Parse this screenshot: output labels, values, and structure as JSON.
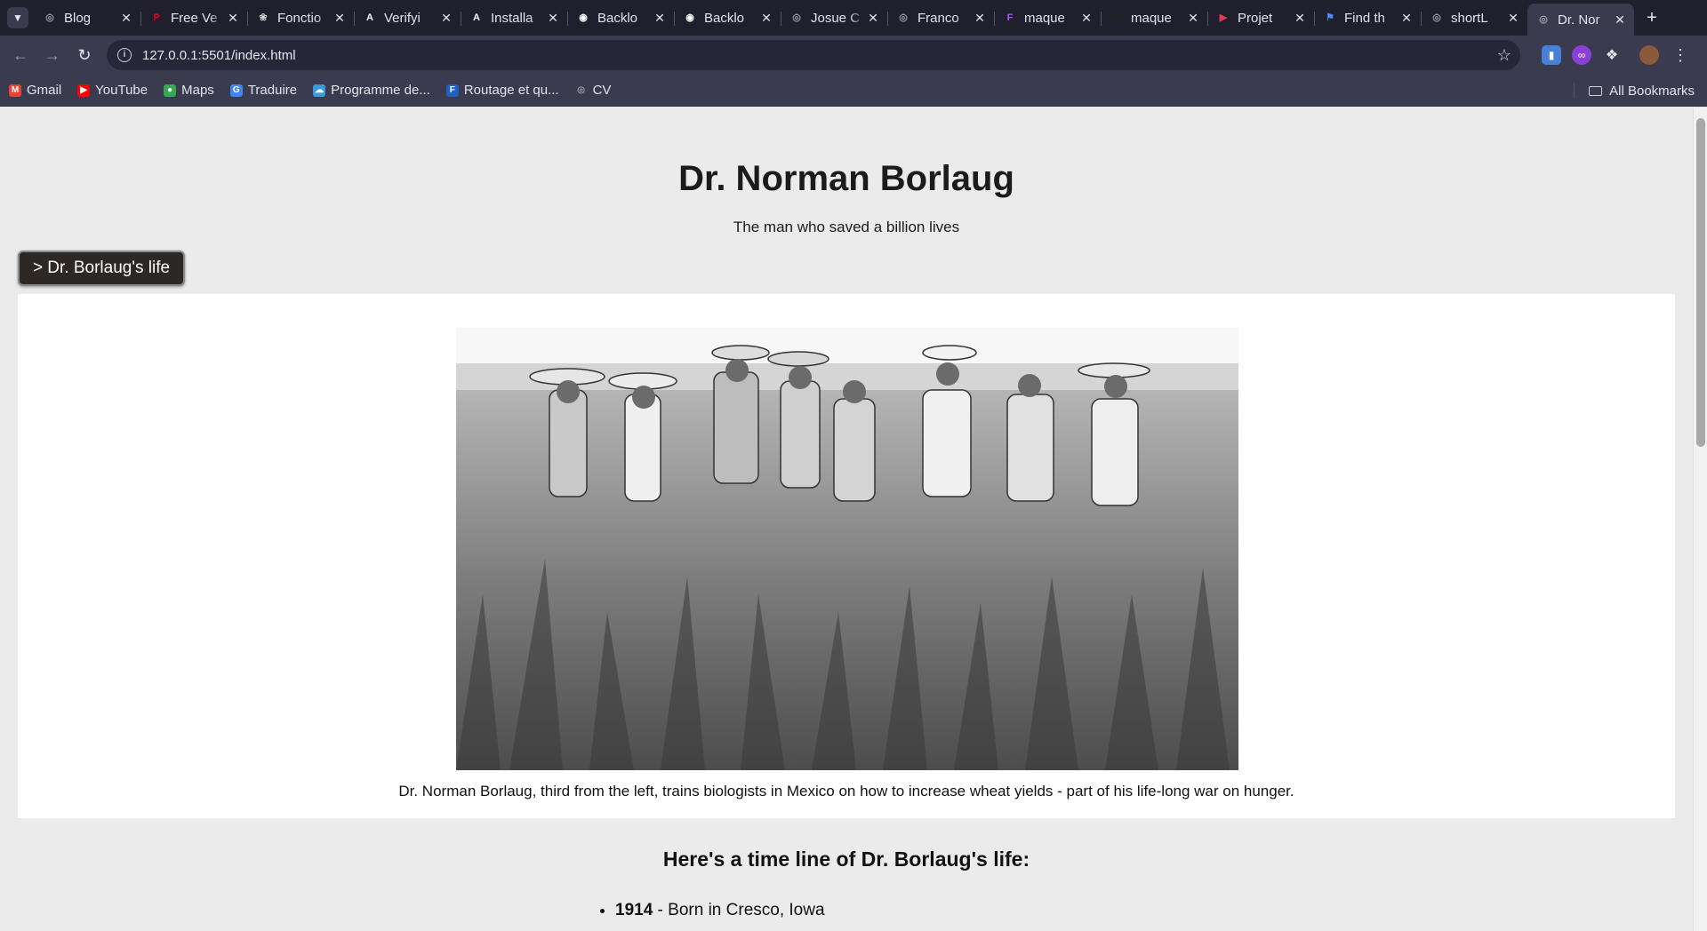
{
  "browser": {
    "tabs": [
      {
        "title": "Blog",
        "icon": "globe-icon",
        "color": "#9aa0a6"
      },
      {
        "title": "Free Ve",
        "icon": "pinterest-icon",
        "color": "#e60023"
      },
      {
        "title": "Fonctio",
        "icon": "openai-icon",
        "color": "#cfcfcf"
      },
      {
        "title": "Verifyi",
        "icon": "auth-icon",
        "color": "#ffffff"
      },
      {
        "title": "Installa",
        "icon": "auth-icon",
        "color": "#ffffff"
      },
      {
        "title": "Backlo",
        "icon": "github-icon",
        "color": "#ffffff"
      },
      {
        "title": "Backlo",
        "icon": "github-icon",
        "color": "#ffffff"
      },
      {
        "title": "Josue C",
        "icon": "globe-icon",
        "color": "#9aa0a6"
      },
      {
        "title": "Franco",
        "icon": "globe-icon",
        "color": "#9aa0a6"
      },
      {
        "title": "maque",
        "icon": "figma-icon",
        "color": "#a259ff"
      },
      {
        "title": "maque",
        "icon": "play-icon",
        "color": "#222222"
      },
      {
        "title": "Projet",
        "icon": "play-icon",
        "color": "#e8364f"
      },
      {
        "title": "Find th",
        "icon": "flag-icon",
        "color": "#4a8cf7"
      },
      {
        "title": "shortL",
        "icon": "globe-icon",
        "color": "#9aa0a6"
      },
      {
        "title": "Dr. Nor",
        "icon": "globe-icon",
        "color": "#9aa0a6",
        "active": true
      }
    ],
    "url": "127.0.0.1:5501/index.html",
    "bookmarks": [
      {
        "label": "Gmail",
        "icon": "gmail-icon",
        "color": "#ea4335"
      },
      {
        "label": "YouTube",
        "icon": "youtube-icon",
        "color": "#ff0000"
      },
      {
        "label": "Maps",
        "icon": "maps-icon",
        "color": "#34a853"
      },
      {
        "label": "Traduire",
        "icon": "translate-icon",
        "color": "#4285f4"
      },
      {
        "label": "Programme de...",
        "icon": "cloud-icon",
        "color": "#3c9ad9"
      },
      {
        "label": "Routage et qu...",
        "icon": "fun-icon",
        "color": "#1f5fbf"
      },
      {
        "label": "CV",
        "icon": "globe-icon",
        "color": "#9aa0a6"
      }
    ],
    "all_bookmarks": "All Bookmarks"
  },
  "page": {
    "title": "Dr. Norman Borlaug",
    "subtitle": "The man who saved a billion lives",
    "life_button": "> Dr. Borlaug's life",
    "caption": "Dr. Norman Borlaug, third from the left, trains biologists in Mexico on how to increase wheat yields - part of his life-long war on hunger.",
    "timeline_heading": "Here's a time line of Dr. Borlaug's life:",
    "timeline": [
      {
        "year": "1914",
        "text": " - Born in Cresco, Iowa"
      }
    ]
  }
}
